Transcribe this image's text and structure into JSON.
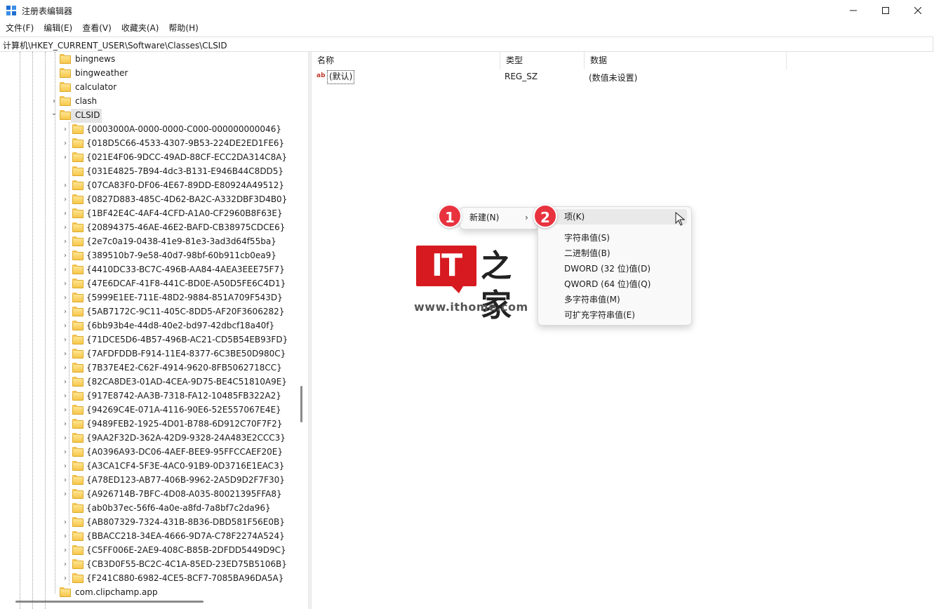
{
  "window": {
    "title": "注册表编辑器"
  },
  "menu": [
    {
      "label": "文件(F)"
    },
    {
      "label": "编辑(E)"
    },
    {
      "label": "查看(V)"
    },
    {
      "label": "收藏夹(A)"
    },
    {
      "label": "帮助(H)"
    }
  ],
  "address": "计算机\\HKEY_CURRENT_USER\\Software\\Classes\\CLSID",
  "tree": {
    "siblings_above": [
      {
        "label": "bingnews",
        "expander": false
      },
      {
        "label": "bingweather",
        "expander": false
      },
      {
        "label": "calculator",
        "expander": false
      },
      {
        "label": "clash",
        "expander": true
      }
    ],
    "selected": {
      "label": "CLSID",
      "expanded": true
    },
    "children": [
      {
        "label": "{0003000A-0000-0000-C000-000000000046}",
        "expander": true
      },
      {
        "label": "{018D5C66-4533-4307-9B53-224DE2ED1FE6}",
        "expander": true
      },
      {
        "label": "{021E4F06-9DCC-49AD-88CF-ECC2DA314C8A}",
        "expander": true
      },
      {
        "label": "{031E4825-7B94-4dc3-B131-E946B44C8DD5}",
        "expander": false
      },
      {
        "label": "{07CA83F0-DF06-4E67-89DD-E80924A49512}",
        "expander": true
      },
      {
        "label": "{0827D883-485C-4D62-BA2C-A332DBF3D4B0}",
        "expander": true
      },
      {
        "label": "{1BF42E4C-4AF4-4CFD-A1A0-CF2960B8F63E}",
        "expander": true
      },
      {
        "label": "{20894375-46AE-46E2-BAFD-CB38975CDCE6}",
        "expander": true
      },
      {
        "label": "{2e7c0a19-0438-41e9-81e3-3ad3d64f55ba}",
        "expander": true
      },
      {
        "label": "{389510b7-9e58-40d7-98bf-60b911cb0ea9}",
        "expander": true
      },
      {
        "label": "{4410DC33-BC7C-496B-AA84-4AEA3EEE75F7}",
        "expander": true
      },
      {
        "label": "{47E6DCAF-41F8-441C-BD0E-A50D5FE6C4D1}",
        "expander": true
      },
      {
        "label": "{5999E1EE-711E-48D2-9884-851A709F543D}",
        "expander": true
      },
      {
        "label": "{5AB7172C-9C11-405C-8DD5-AF20F3606282}",
        "expander": true
      },
      {
        "label": "{6bb93b4e-44d8-40e2-bd97-42dbcf18a40f}",
        "expander": true
      },
      {
        "label": "{71DCE5D6-4B57-496B-AC21-CD5B54EB93FD}",
        "expander": true
      },
      {
        "label": "{7AFDFDDB-F914-11E4-8377-6C3BE50D980C}",
        "expander": true
      },
      {
        "label": "{7B37E4E2-C62F-4914-9620-8FB5062718CC}",
        "expander": true
      },
      {
        "label": "{82CA8DE3-01AD-4CEA-9D75-BE4C51810A9E}",
        "expander": true
      },
      {
        "label": "{917E8742-AA3B-7318-FA12-10485FB322A2}",
        "expander": true
      },
      {
        "label": "{94269C4E-071A-4116-90E6-52E557067E4E}",
        "expander": true
      },
      {
        "label": "{9489FEB2-1925-4D01-B788-6D912C70F7F2}",
        "expander": true
      },
      {
        "label": "{9AA2F32D-362A-42D9-9328-24A483E2CCC3}",
        "expander": true
      },
      {
        "label": "{A0396A93-DC06-4AEF-BEE9-95FFCCAEF20E}",
        "expander": true
      },
      {
        "label": "{A3CA1CF4-5F3E-4AC0-91B9-0D3716E1EAC3}",
        "expander": true
      },
      {
        "label": "{A78ED123-AB77-406B-9962-2A5D9D2F7F30}",
        "expander": true
      },
      {
        "label": "{A926714B-7BFC-4D08-A035-80021395FFA8}",
        "expander": true
      },
      {
        "label": "{ab0b37ec-56f6-4a0e-a8fd-7a8bf7c2da96}",
        "expander": false
      },
      {
        "label": "{AB807329-7324-431B-8B36-DBD581F56E0B}",
        "expander": true
      },
      {
        "label": "{BBACC218-34EA-4666-9D7A-C78F2274A524}",
        "expander": true
      },
      {
        "label": "{C5FF006E-2AE9-408C-B85B-2DFDD5449D9C}",
        "expander": true
      },
      {
        "label": "{CB3D0F55-BC2C-4C1A-85ED-23ED75B5106B}",
        "expander": true
      },
      {
        "label": "{F241C880-6982-4CE5-8CF7-7085BA96DA5A}",
        "expander": true
      }
    ],
    "sibling_below": {
      "label": "com.clipchamp.app"
    }
  },
  "list": {
    "headers": {
      "name": "名称",
      "type": "类型",
      "data": "数据"
    },
    "rows": [
      {
        "name": "(默认)",
        "type": "REG_SZ",
        "data": "(数值未设置)",
        "icon": "ab"
      }
    ]
  },
  "context_menu": {
    "new_label": "新建(N)",
    "arrow": "›",
    "submenu": [
      {
        "label": "项(K)"
      },
      {
        "label": "字符串值(S)"
      },
      {
        "label": "二进制值(B)"
      },
      {
        "label": "DWORD (32 位)值(D)"
      },
      {
        "label": "QWORD (64 位)值(Q)"
      },
      {
        "label": "多字符串值(M)"
      },
      {
        "label": "可扩充字符串值(E)"
      }
    ]
  },
  "annotations": {
    "badge_1": "1",
    "badge_2": "2"
  },
  "watermark": {
    "logo": "IT",
    "url": "www.ithome.com"
  },
  "colors": {
    "badge": "#e8333f",
    "folder": "#f7c64a",
    "logo_red": "#d71920"
  }
}
